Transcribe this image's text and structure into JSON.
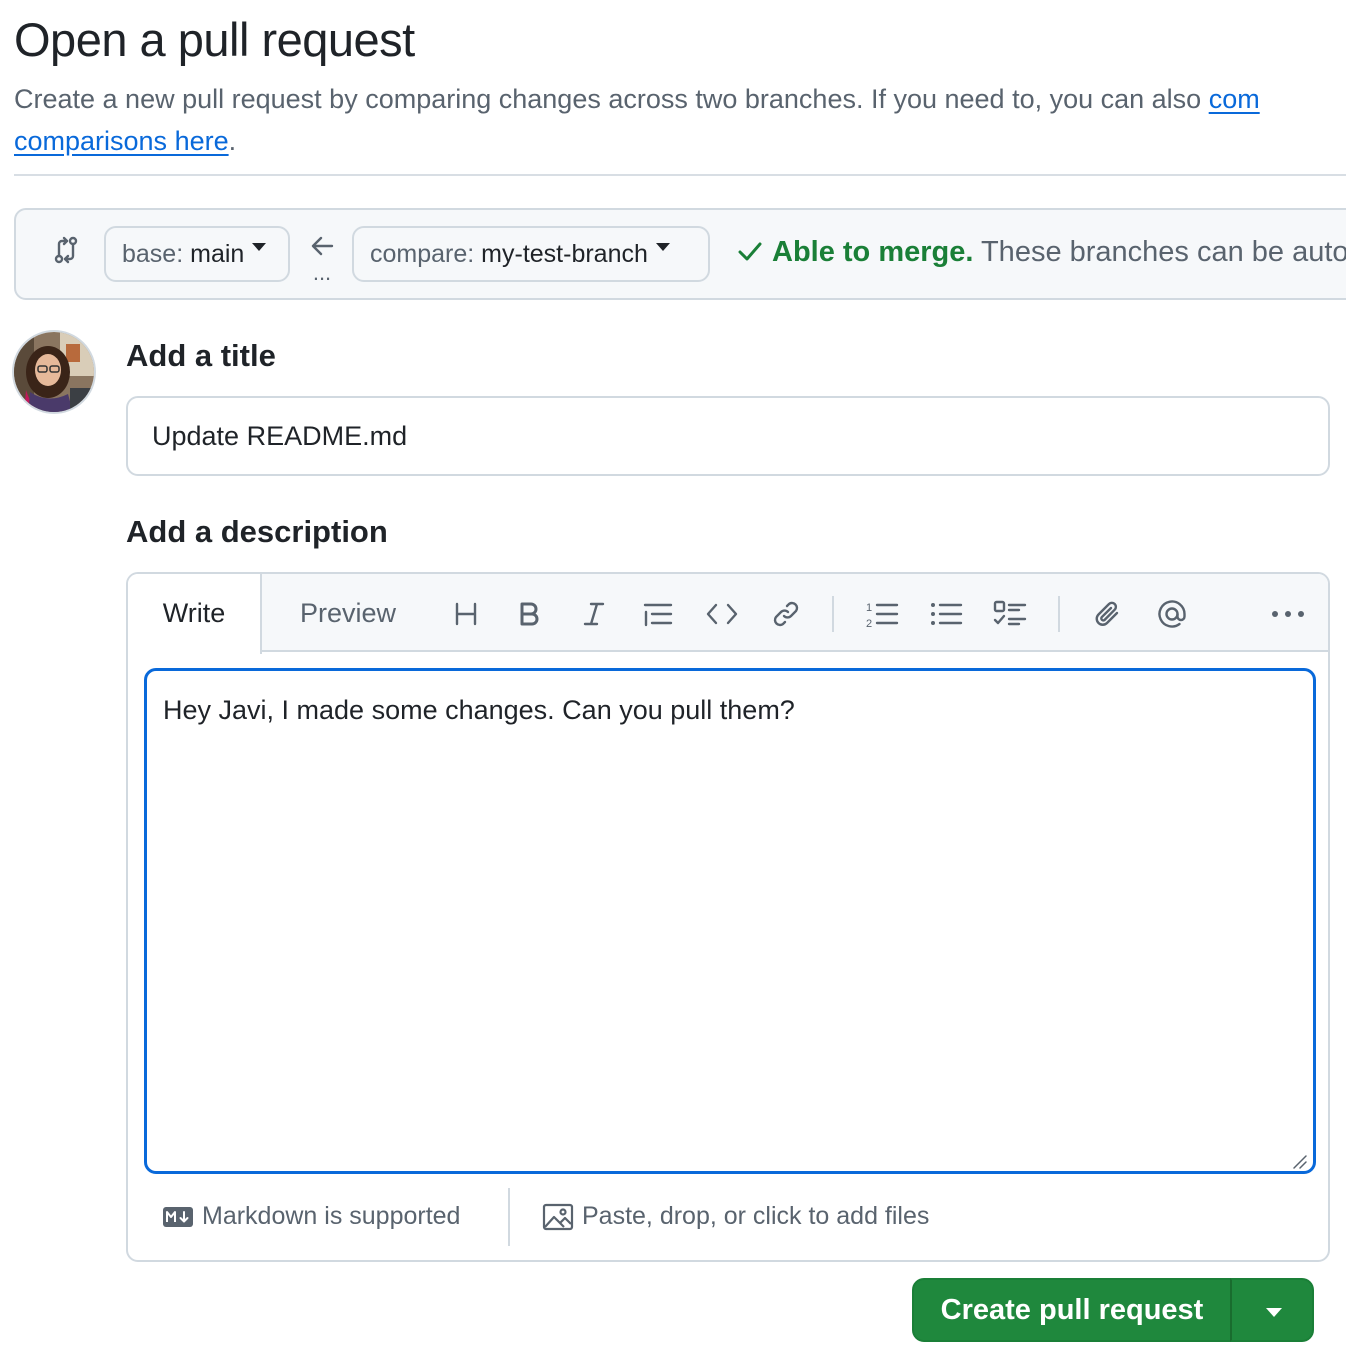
{
  "header": {
    "title": "Open a pull request",
    "subtitle_text": "Create a new pull request by comparing changes across two branches. If you need to, you can also ",
    "subtitle_link_part1": "com",
    "subtitle_link_part2": "comparisons here",
    "subtitle_end": "."
  },
  "range": {
    "base_prefix": "base:",
    "base_value": "main",
    "compare_prefix": "compare:",
    "compare_value": "my-test-branch",
    "dots": "...",
    "merge_ok": "Able to merge.",
    "merge_text": " These branches can be autor"
  },
  "form": {
    "title_label": "Add a title",
    "title_value": "Update README.md",
    "description_label": "Add a description",
    "description_value": "Hey Javi, I made some changes. Can you pull them?"
  },
  "editor": {
    "tab_write": "Write",
    "tab_preview": "Preview",
    "footer_markdown": "Markdown is supported",
    "footer_files": "Paste, drop, or click to add files"
  },
  "actions": {
    "create_label": "Create pull request"
  },
  "colors": {
    "accent": "#0969da",
    "success": "#1a7f37",
    "primary_button": "#1f883d"
  }
}
